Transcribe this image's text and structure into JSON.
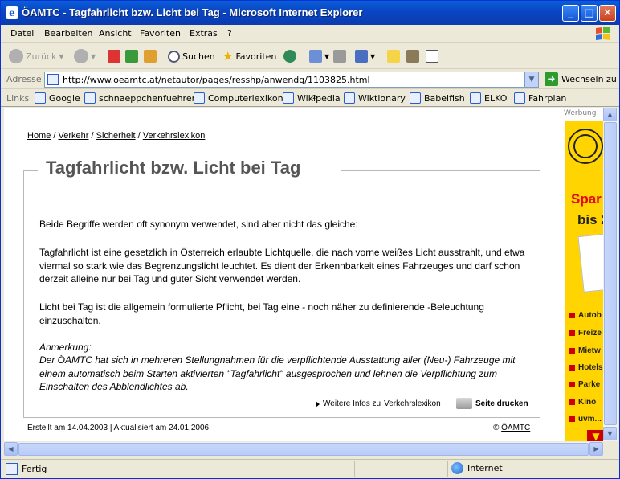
{
  "window": {
    "title": "ÖAMTC - Tagfahrlicht bzw. Licht bei Tag - Microsoft Internet Explorer",
    "min": "_",
    "max": "□",
    "close": "✕"
  },
  "menu": [
    "Datei",
    "Bearbeiten",
    "Ansicht",
    "Favoriten",
    "Extras",
    "?"
  ],
  "toolbar": {
    "back": "Zurück",
    "search": "Suchen",
    "favorites": "Favoriten"
  },
  "address": {
    "label": "Adresse",
    "url": "http://www.oeamtc.at/netautor/pages/resshp/anwendg/1103825.html",
    "go": "Wechseln zu"
  },
  "links": {
    "label": "Links",
    "items": [
      "Google",
      "schnaeppchenfuehrer",
      "Computerlexikon",
      "Wikipedia",
      "Wiktionary",
      "Babelfish",
      "ELKO",
      "Fahrplan"
    ],
    "more": "»"
  },
  "page": {
    "breadcrumb": [
      "Home",
      "Verkehr",
      "Sicherheit",
      "Verkehrslexikon"
    ],
    "sep": "/",
    "heading": "Tagfahrlicht bzw. Licht bei Tag",
    "p1": "Beide Begriffe werden oft synonym verwendet, sind aber nicht das gleiche:",
    "p2": "Tagfahrlicht ist eine gesetzlich in Österreich erlaubte Lichtquelle, die nach vorne weißes Licht ausstrahlt, und etwa viermal so stark wie das Begrenzungslicht leuchtet. Es dient der Erkennbarkeit eines Fahrzeuges und darf schon derzeit alleine nur bei Tag und guter Sicht verwendet werden.",
    "p3": "Licht bei Tag ist die allgemein formulierte Pflicht, bei Tag eine - noch näher zu definierende -Beleuchtung einzuschalten.",
    "note_title": "Anmerkung:",
    "note": "Der ÖAMTC hat sich in mehreren Stellungnahmen für die verpflichtende Ausstattung aller (Neu-) Fahrzeuge mit einem automatisch beim Starten aktivierten \"Tagfahrlicht\" ausgesprochen und lehnen die Verpflichtung zum Einschalten des Abblendlichtes ab.",
    "more_prefix": "Weitere Infos zu",
    "more_link": "Verkehrslexikon",
    "print": "Seite drucken",
    "footer": "Erstellt am 14.04.2003 | Aktualisiert am 24.01.2006",
    "copy_sym": "©",
    "copy_link": "ÖAMTC"
  },
  "ad": {
    "label": "Werbung",
    "big1": "Spar",
    "big2": "bis 2",
    "items": [
      "Autob",
      "Freize",
      "Mietw",
      "Hotels",
      "Parke",
      "Kino",
      "uvm..."
    ]
  },
  "status": {
    "text": "Fertig",
    "zone": "Internet"
  },
  "colors": {
    "titlebar": "#0a47c4",
    "ad_yellow": "#ffd400",
    "ad_red": "#e30613"
  }
}
